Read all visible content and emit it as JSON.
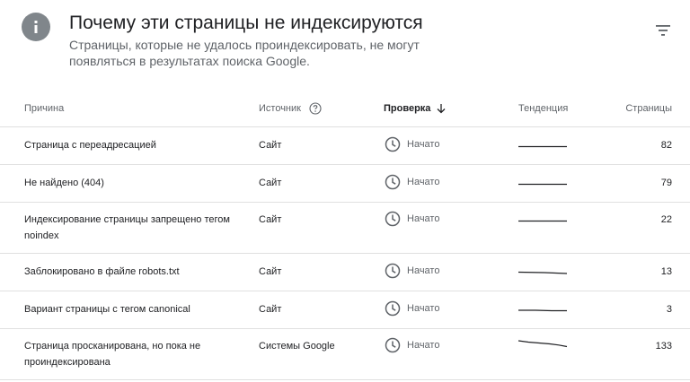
{
  "header": {
    "icon": "info-icon",
    "title": "Почему эти страницы не индексируются",
    "subtitle": "Страницы, которые не удалось проиндексировать, не могут появляться в результатах поиска Google.",
    "filter_icon": "filter-icon"
  },
  "table": {
    "columns": {
      "reason": "Причина",
      "source": "Источник",
      "check": "Проверка",
      "trend": "Тенденция",
      "pages": "Страницы"
    },
    "rows": [
      {
        "reason": "Страница с переадресацией",
        "source": "Сайт",
        "status": "Начато",
        "pages": "82"
      },
      {
        "reason": "Не найдено (404)",
        "source": "Сайт",
        "status": "Начато",
        "pages": "79"
      },
      {
        "reason": "Индексирование страницы запрещено тегом noindex",
        "source": "Сайт",
        "status": "Начато",
        "pages": "22"
      },
      {
        "reason": "Заблокировано в файле robots.txt",
        "source": "Сайт",
        "status": "Начато",
        "pages": "13"
      },
      {
        "reason": "Вариант страницы с тегом canonical",
        "source": "Сайт",
        "status": "Начато",
        "pages": "3"
      },
      {
        "reason": "Страница просканирована, но пока не проиндексирована",
        "source": "Системы Google",
        "status": "Начато",
        "pages": "133"
      }
    ]
  },
  "colors": {
    "text": "#202124",
    "secondary": "#5f6368",
    "icon_gray": "#80868b",
    "divider": "#e0e0e0"
  }
}
